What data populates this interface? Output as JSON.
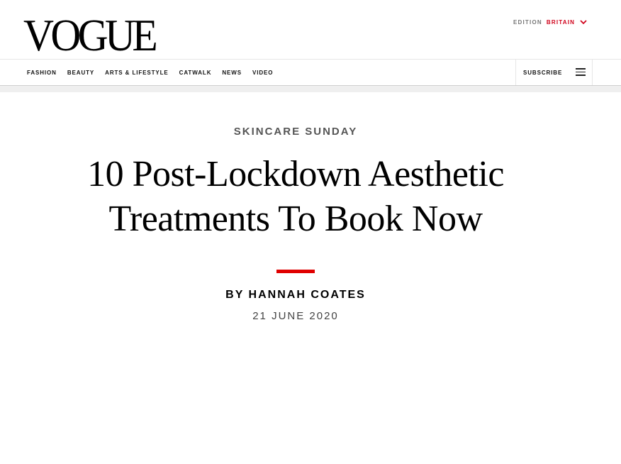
{
  "header": {
    "logo": "VOGUE",
    "edition_label": "EDITION",
    "edition_value": "BRITAIN",
    "accent_color": "#d0021b"
  },
  "nav": {
    "items": [
      "FASHION",
      "BEAUTY",
      "ARTS & LIFESTYLE",
      "CATWALK",
      "NEWS",
      "VIDEO"
    ],
    "subscribe": "SUBSCRIBE",
    "menu_icon": "hamburger-menu-icon"
  },
  "article": {
    "kicker": "SKINCARE SUNDAY",
    "headline": "10 Post-Lockdown Aesthetic Treatments To Book Now",
    "byline": "BY HANNAH COATES",
    "date": "21 JUNE 2020",
    "rule_color": "#e00000"
  }
}
